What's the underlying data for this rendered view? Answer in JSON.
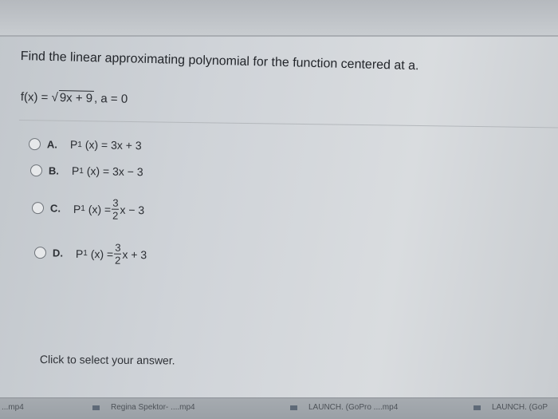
{
  "question": {
    "prompt": "Find the linear approximating polynomial for the function centered at a.",
    "function_prefix": "f(x) =",
    "function_radicand": "9x + 9",
    "center": ", a = 0"
  },
  "options": [
    {
      "letter": "A.",
      "lhs": "P",
      "sub": "1",
      "arg": "(x) =",
      "pre": "",
      "frac_num": "",
      "frac_den": "",
      "post": "3x + 3"
    },
    {
      "letter": "B.",
      "lhs": "P",
      "sub": "1",
      "arg": "(x) =",
      "pre": "",
      "frac_num": "",
      "frac_den": "",
      "post": "3x − 3"
    },
    {
      "letter": "C.",
      "lhs": "P",
      "sub": "1",
      "arg": "(x) =",
      "frac_num": "3",
      "frac_den": "2",
      "post": "x − 3"
    },
    {
      "letter": "D.",
      "lhs": "P",
      "sub": "1",
      "arg": "(x) =",
      "frac_num": "3",
      "frac_den": "2",
      "post": "x + 3"
    }
  ],
  "hint": "Click to select your answer.",
  "taskbar": [
    {
      "label": "...mp4"
    },
    {
      "label": "Regina Spektor- ....mp4"
    },
    {
      "label": "LAUNCH. (GoPro ....mp4"
    },
    {
      "label": "LAUNCH. (GoP"
    }
  ],
  "colors": {
    "radio_border": "#6f747a",
    "text": "#2b2e33"
  }
}
